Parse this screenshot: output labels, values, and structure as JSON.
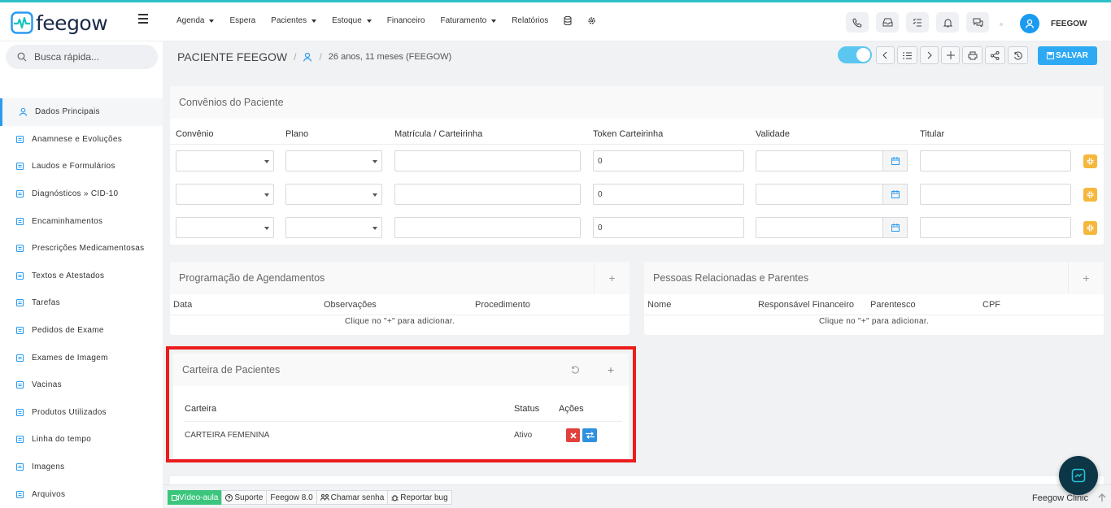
{
  "app": {
    "name": "feegow",
    "user": "FEEGOW"
  },
  "menu": [
    {
      "label": "Agenda",
      "caret": true
    },
    {
      "label": "Espera",
      "caret": false
    },
    {
      "label": "Pacientes",
      "caret": true
    },
    {
      "label": "Estoque",
      "caret": true
    },
    {
      "label": "Financeiro",
      "caret": false
    },
    {
      "label": "Faturamento",
      "caret": true
    },
    {
      "label": "Relatórios",
      "caret": false
    }
  ],
  "search": {
    "placeholder": "Busca rápida..."
  },
  "sidebar": {
    "items": [
      {
        "label": "Dados Principais",
        "icon": "user-icon",
        "active": true
      },
      {
        "label": "Anamnese e Evoluções",
        "icon": "chart-icon"
      },
      {
        "label": "Laudos e Formulários",
        "icon": "clipboard-icon"
      },
      {
        "label": "Diagnósticos » CID-10",
        "icon": "stethoscope-icon"
      },
      {
        "label": "Encaminhamentos",
        "icon": "document-icon"
      },
      {
        "label": "Prescrições Medicamentosas",
        "icon": "pills-icon"
      },
      {
        "label": "Textos e Atestados",
        "icon": "file-text-icon"
      },
      {
        "label": "Tarefas",
        "icon": "tasks-icon"
      },
      {
        "label": "Pedidos de Exame",
        "icon": "exam-icon"
      },
      {
        "label": "Exames de Imagem",
        "icon": "image-exam-icon"
      },
      {
        "label": "Vacinas",
        "icon": "syringe-icon"
      },
      {
        "label": "Produtos Utilizados",
        "icon": "box-icon"
      },
      {
        "label": "Linha do tempo",
        "icon": "timeline-icon"
      },
      {
        "label": "Imagens",
        "icon": "camera-icon"
      },
      {
        "label": "Arquivos",
        "icon": "file-icon"
      }
    ]
  },
  "patient": {
    "name": "PACIENTE FEEGOW",
    "sep": "/",
    "age": "26 anos, 11 meses (FEEGOW)"
  },
  "actions": {
    "save_label": "SALVAR"
  },
  "convenios": {
    "title": "Convênios do Paciente",
    "columns": [
      "Convênio",
      "Plano",
      "Matrícula / Carteirinha",
      "Token Carteirinha",
      "Validade",
      "Titular"
    ],
    "rows": [
      {
        "token": "0"
      },
      {
        "token": "0"
      },
      {
        "token": "0"
      }
    ]
  },
  "programacao": {
    "title": "Programação de Agendamentos",
    "columns": [
      "Data",
      "Observações",
      "Procedimento"
    ],
    "empty": "Clique no \"+\" para adicionar."
  },
  "pessoas": {
    "title": "Pessoas Relacionadas e Parentes",
    "columns": [
      "Nome",
      "Responsável Financeiro",
      "Parentesco",
      "CPF"
    ],
    "empty": "Clique no \"+\" para adicionar."
  },
  "carteira": {
    "title": "Carteira de Pacientes",
    "columns": [
      "Carteira",
      "Status",
      "Ações"
    ],
    "rows": [
      {
        "name": "CARTEIRA FEMENINA",
        "status": "Ativo"
      }
    ]
  },
  "footer": {
    "items": [
      "Vídeo-aula",
      "Suporte",
      "Feegow 8.0",
      "Chamar senha",
      "Reportar bug"
    ],
    "clinic": "Feegow Clinic"
  },
  "colors": {
    "accent": "#2eaaf4",
    "highlight": "#ec1c1c",
    "warning": "#f5b73c",
    "danger": "#e1413c"
  }
}
